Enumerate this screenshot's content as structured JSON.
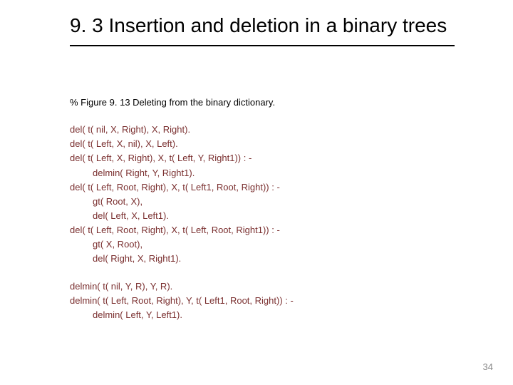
{
  "title": "9. 3 Insertion and deletion in a binary trees",
  "comment": "% Figure 9. 13  Deleting from the binary dictionary.",
  "code": {
    "l1": "del( t( nil, X, Right), X, Right).",
    "l2": "del( t( Left, X, nil), X, Left).",
    "l3": "del( t( Left, X, Right), X, t( Left, Y, Right1))  : -",
    "l4": "delmin( Right, Y, Right1).",
    "l5": "del( t( Left, Root, Right), X, t( Left1, Root, Right))  : -",
    "l6": "gt( Root, X),",
    "l7": "del( Left, X, Left1).",
    "l8": "del( t( Left, Root, Right), X, t( Left, Root, Right1))  : -",
    "l9": "gt( X, Root),",
    "l10": "del( Right, X, Right1).",
    "l11": "delmin( t( nil, Y, R), Y, R).",
    "l12": "delmin( t( Left, Root, Right), Y, t( Left1, Root, Right))  : -",
    "l13": "delmin( Left, Y, Left1)."
  },
  "page_number": "34"
}
